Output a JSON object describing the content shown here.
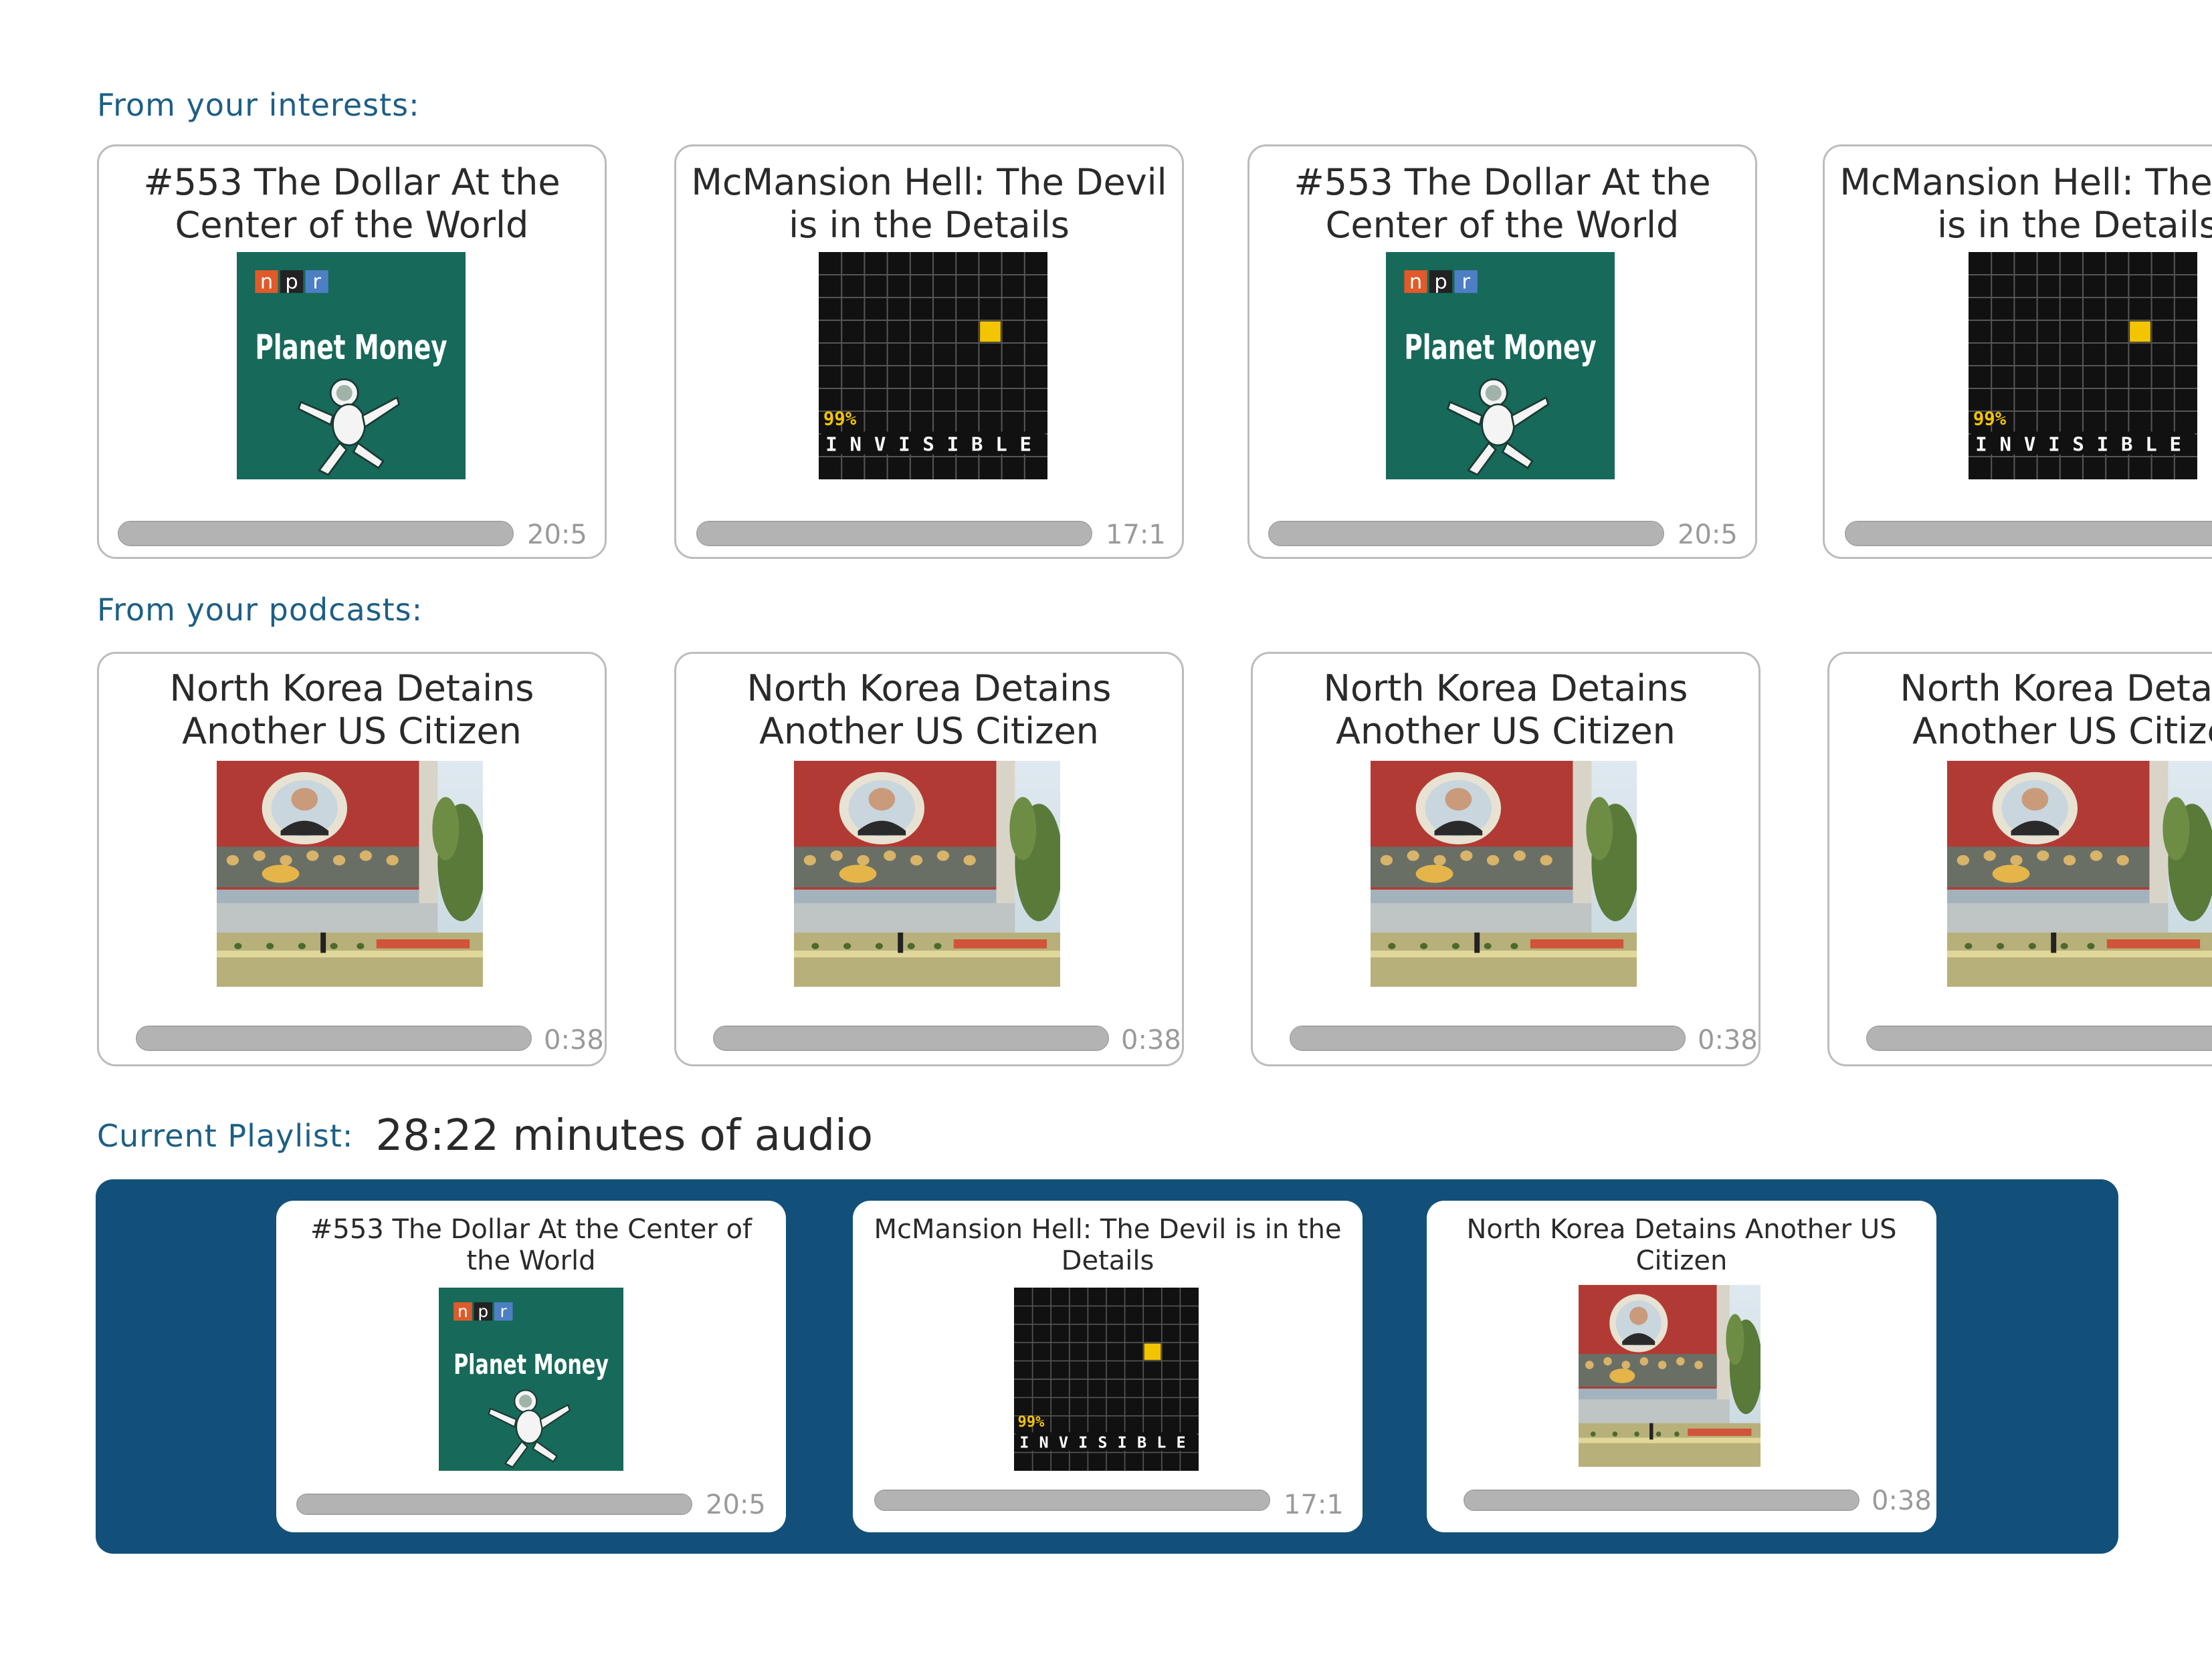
{
  "colors": {
    "section_label": "#1d5f86",
    "playlist_background": "#12507a",
    "progress_bar": "#b3b3b3",
    "planet_money_green": "#17695a",
    "invisible_black": "#111111",
    "invisible_yellow": "#f3c400"
  },
  "interests": {
    "label": "From your interests:",
    "cards": [
      {
        "title": "#553 The Dollar At the Center of the World",
        "art": "planet-money-artwork",
        "duration": "20:5",
        "progress": 1.0
      },
      {
        "title": "McMansion Hell: The Devil is in the Details",
        "art": "99-invisible-artwork",
        "duration": "17:1",
        "progress": 1.0
      },
      {
        "title": "#553 The Dollar At the Center of the World",
        "art": "planet-money-artwork",
        "duration": "20:5",
        "progress": 1.0
      },
      {
        "title": "McMansion Hell: The Devil is in the Details",
        "art": "99-invisible-artwork",
        "duration": "",
        "progress": 1.0
      }
    ]
  },
  "podcasts": {
    "label": "From your podcasts:",
    "cards": [
      {
        "title": "North Korea Detains Another US Citizen",
        "art": "north-korea-photo",
        "duration": "0:38",
        "progress": 1.0
      },
      {
        "title": "North Korea Detains Another US Citizen",
        "art": "north-korea-photo",
        "duration": "0:38",
        "progress": 1.0
      },
      {
        "title": "North Korea Detains Another US Citizen",
        "art": "north-korea-photo",
        "duration": "0:38",
        "progress": 1.0
      },
      {
        "title": "North Korea Detains Another US Citizen",
        "art": "north-korea-photo",
        "duration": "",
        "progress": 1.0
      }
    ]
  },
  "playlist": {
    "label": "Current Playlist:",
    "summary": "28:22 minutes of audio",
    "cards": [
      {
        "title": "#553 The Dollar At the Center of the World",
        "art": "planet-money-artwork",
        "duration": "20:5",
        "progress": 1.0
      },
      {
        "title": "McMansion Hell: The Devil is in the Details",
        "art": "99-invisible-artwork",
        "duration": "17:1",
        "progress": 1.0
      },
      {
        "title": "North Korea Detains Another US Citizen",
        "art": "north-korea-photo",
        "duration": "0:38",
        "progress": 1.0
      }
    ]
  },
  "artwork": {
    "planet_money": {
      "brand_letters": [
        "n",
        "p",
        "r"
      ],
      "show_name": "Planet Money"
    },
    "invisible": {
      "logo_top": "99%",
      "logo_bottom": "INVISIBLE"
    }
  }
}
